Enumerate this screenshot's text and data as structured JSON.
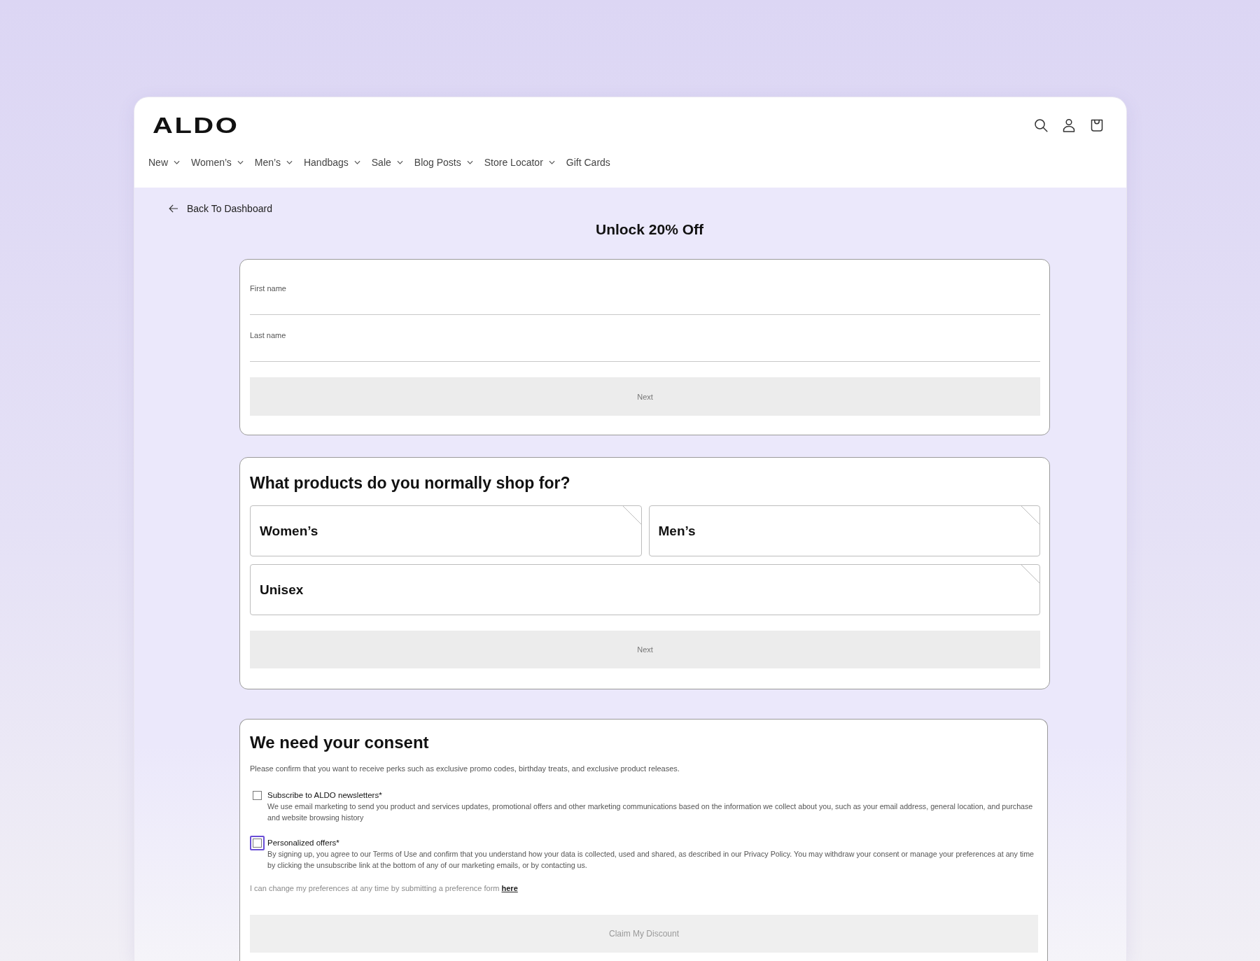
{
  "header": {
    "logo": "ALDO",
    "nav": [
      {
        "label": "New",
        "has_menu": true
      },
      {
        "label": "Women’s",
        "has_menu": true
      },
      {
        "label": "Men’s",
        "has_menu": true
      },
      {
        "label": "Handbags",
        "has_menu": true
      },
      {
        "label": "Sale",
        "has_menu": true
      },
      {
        "label": "Blog Posts",
        "has_menu": true
      },
      {
        "label": "Store Locator",
        "has_menu": true
      },
      {
        "label": "Gift Cards",
        "has_menu": false
      }
    ]
  },
  "page": {
    "back_link": "Back To Dashboard",
    "title": "Unlock 20% Off"
  },
  "name_form": {
    "fields": [
      {
        "label": "First name"
      },
      {
        "label": "Last name"
      }
    ],
    "button": {
      "label": "Next",
      "disabled": true
    }
  },
  "products_form": {
    "title": "What products do you normally shop for?",
    "options": [
      {
        "label": "Women’s",
        "selected": false
      },
      {
        "label": "Men’s",
        "selected": false
      },
      {
        "label": "Unisex",
        "selected": false
      }
    ],
    "button": {
      "label": "Next",
      "disabled": true
    }
  },
  "consent_form": {
    "title": "We need your consent",
    "intro": "Please confirm that you want to receive perks such as exclusive promo codes, birthday treats, and exclusive product releases.",
    "checkboxes": [
      {
        "label": "Subscribe to ALDO newsletters*",
        "description": "We use email marketing to send you product and services updates, promotional offers and other marketing communications based on the information we collect about you, such as your email address, general location, and purchase and website browsing history",
        "checked": false,
        "focused": false
      },
      {
        "label": "Personalized offers*",
        "description": "By signing up, you agree to our Terms of Use and confirm that you understand how your data is collected, used and shared, as described in our Privacy Policy. You may withdraw your consent or manage your preferences at any time by clicking the unsubscribe link at the bottom of any of our marketing emails, or by contacting us.",
        "checked": false,
        "focused": true
      }
    ],
    "preference_note": "I can change my preferences at any time by submitting a preference form",
    "preference_link": "here",
    "button": {
      "label": "Claim My Discount",
      "disabled": true
    }
  }
}
